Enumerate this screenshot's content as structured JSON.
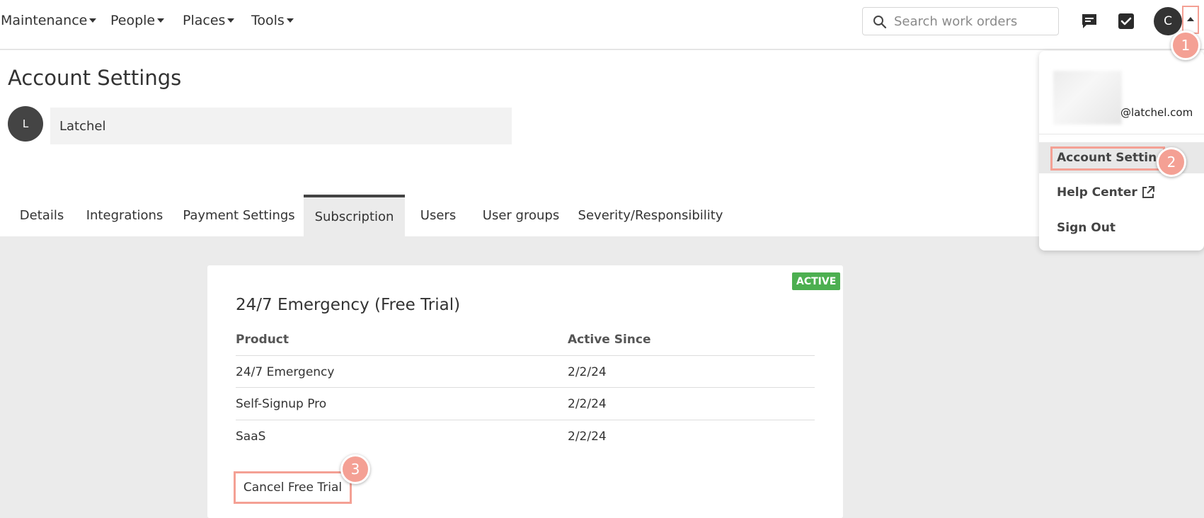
{
  "nav": {
    "items": [
      {
        "label": "Maintenance"
      },
      {
        "label": "People"
      },
      {
        "label": "Places"
      },
      {
        "label": "Tools"
      }
    ],
    "search_placeholder": "Search work orders",
    "avatar_initial": "C"
  },
  "page": {
    "title": "Account Settings",
    "org_avatar_initial": "L",
    "org_name": "Latchel"
  },
  "tabs": [
    {
      "label": "Details"
    },
    {
      "label": "Integrations"
    },
    {
      "label": "Payment Settings"
    },
    {
      "label": "Subscription",
      "active": true
    },
    {
      "label": "Users"
    },
    {
      "label": "User groups"
    },
    {
      "label": "Severity/Responsibility"
    }
  ],
  "subscription": {
    "status": "ACTIVE",
    "status_color": "#4caf50",
    "title": "24/7 Emergency (Free Trial)",
    "columns": [
      "Product",
      "Active Since"
    ],
    "rows": [
      {
        "product": "24/7 Emergency",
        "since": "2/2/24"
      },
      {
        "product": "Self-Signup Pro",
        "since": "2/2/24"
      },
      {
        "product": "SaaS",
        "since": "2/2/24"
      }
    ],
    "cancel_label": "Cancel Free Trial"
  },
  "dropdown": {
    "email_domain": "@latchel.com",
    "items": [
      {
        "label": "Account Settings"
      },
      {
        "label": "Help Center"
      },
      {
        "label": "Sign Out"
      }
    ]
  },
  "steps": [
    "1",
    "2",
    "3"
  ],
  "colors": {
    "highlight": "#f4a094",
    "active_badge": "#4caf50",
    "page_bg": "#ebebeb"
  }
}
